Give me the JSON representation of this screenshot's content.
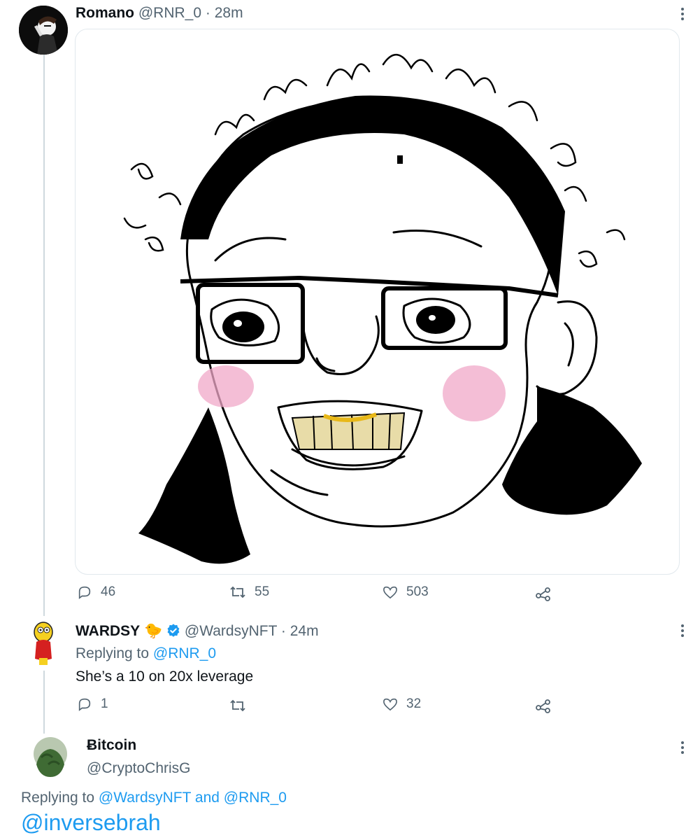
{
  "tweet1": {
    "display_name": "Romano",
    "handle": "@RNR_0",
    "separator": "·",
    "time": "28m",
    "stats": {
      "replies": "46",
      "retweets": "55",
      "likes": "503"
    },
    "media_icon": "hand-drawn-face-image"
  },
  "tweet2": {
    "display_name": "WARDSY",
    "emoji": "🐤",
    "handle": "@WardsyNFT",
    "separator": "·",
    "time": "24m",
    "replying_prefix": "Replying to",
    "replying_handle": "@RNR_0",
    "text": "She’s a 10 on 20x leverage",
    "stats": {
      "replies": "1",
      "retweets": "",
      "likes": "32"
    }
  },
  "tweet3": {
    "display_name": "Ƀitcoin",
    "handle": "@CryptoChrisG",
    "replying_prefix": "Replying to",
    "replying_handle_1": "@WardsyNFT",
    "replying_and": "and",
    "replying_handle_2": "@RNR_0",
    "text": "@inversebrah"
  },
  "colors": {
    "link": "#1d9bf0",
    "muted": "#536471",
    "verified": "#1d9bf0",
    "thread_line": "#cfd9de"
  }
}
